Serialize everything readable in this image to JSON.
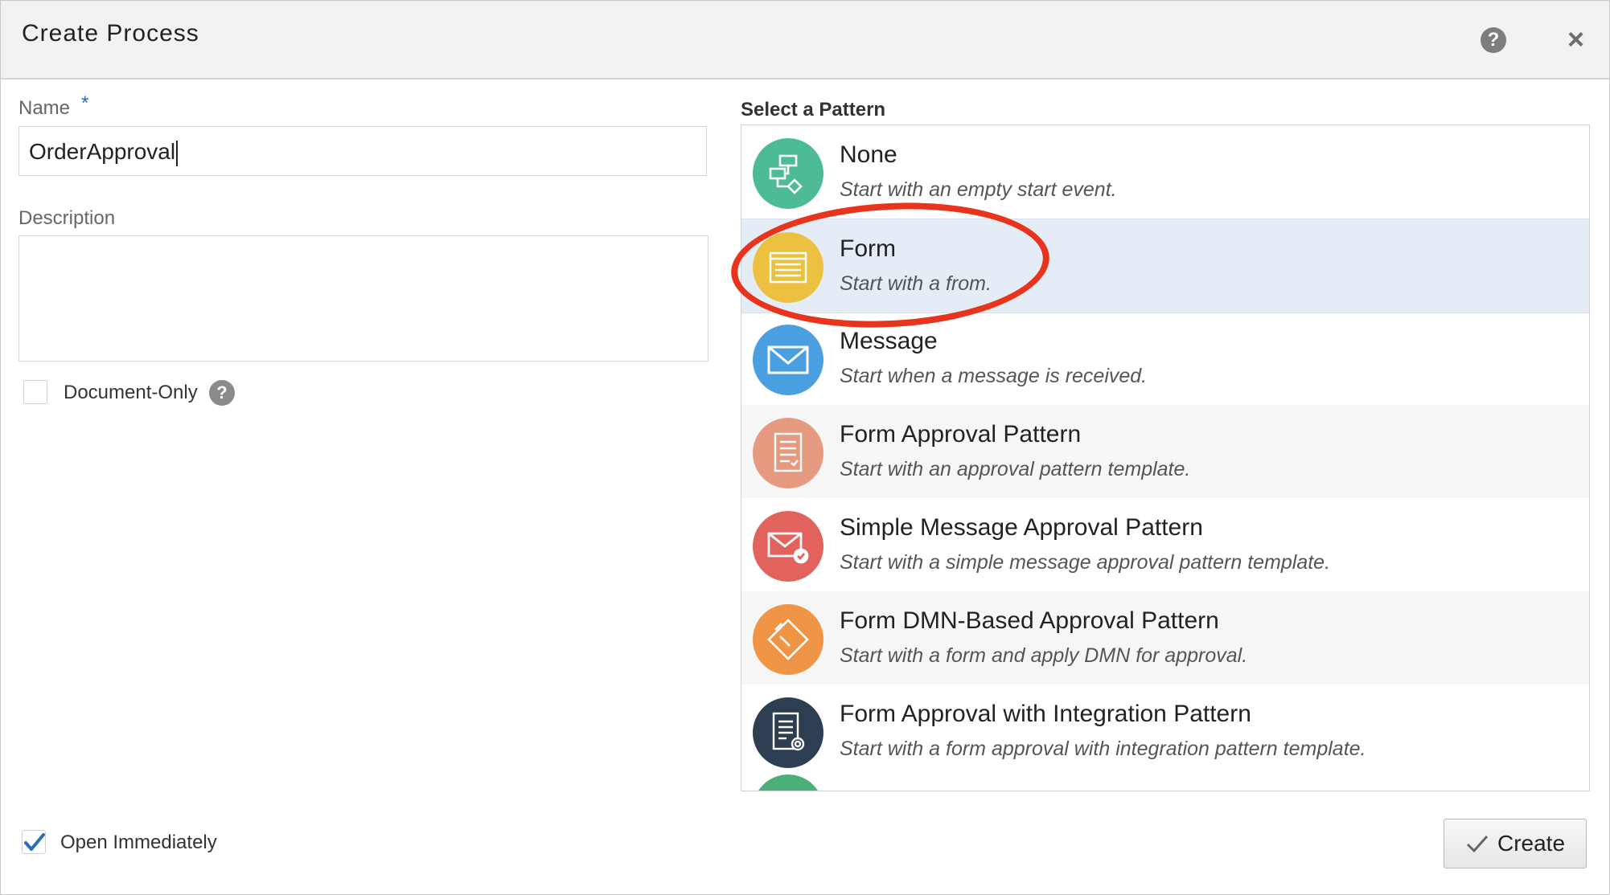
{
  "dialog": {
    "title": "Create Process"
  },
  "header": {
    "help_icon": "?",
    "close_icon": "×"
  },
  "form": {
    "name_label": "Name",
    "name_required_marker": "*",
    "name_value": "OrderApproval",
    "description_label": "Description",
    "description_value": "",
    "document_only_label": "Document-Only",
    "document_only_checked": false,
    "document_only_help": "?"
  },
  "patterns": {
    "heading": "Select a Pattern",
    "selected": "Form",
    "items": [
      {
        "title": "None",
        "description": "Start with an empty start event.",
        "icon": "flow-diagram-icon",
        "color": "#4dba98"
      },
      {
        "title": "Form",
        "description": "Start with a from.",
        "icon": "form-icon",
        "color": "#ecc13f"
      },
      {
        "title": "Message",
        "description": "Start when a message is received.",
        "icon": "envelope-icon",
        "color": "#4a9fe0"
      },
      {
        "title": "Form Approval Pattern",
        "description": "Start with an approval pattern template.",
        "icon": "checklist-icon",
        "color": "#e59a7f"
      },
      {
        "title": "Simple Message Approval Pattern",
        "description": "Start with a simple message approval pattern template.",
        "icon": "envelope-check-icon",
        "color": "#e2625e"
      },
      {
        "title": "Form DMN-Based Approval Pattern",
        "description": "Start with a form and apply DMN for approval.",
        "icon": "diamond-icon",
        "color": "#ef9545"
      },
      {
        "title": "Form Approval with Integration Pattern",
        "description": "Start with a form approval with integration pattern template.",
        "icon": "document-gear-icon",
        "color": "#2e3e52"
      }
    ]
  },
  "footer": {
    "open_immediately_label": "Open Immediately",
    "open_immediately_checked": true,
    "create_label": "Create",
    "create_icon": "checkmark-icon"
  },
  "colors": {
    "annotation": "#e8341c",
    "selected_row": "#e4edf6",
    "check": "#2a6ebb"
  }
}
